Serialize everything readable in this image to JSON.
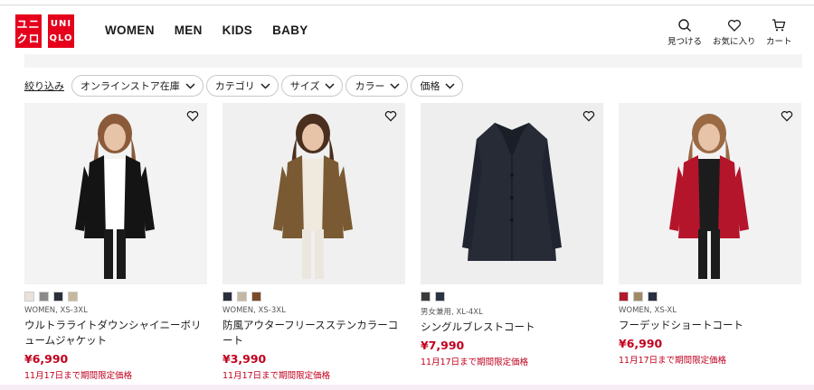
{
  "header": {
    "logo_jp_lines": [
      "ユニ",
      "クロ"
    ],
    "logo_en_lines": [
      "UNI",
      "QLO"
    ],
    "nav": [
      "WOMEN",
      "MEN",
      "KIDS",
      "BABY"
    ],
    "icons": [
      {
        "icon": "search-icon",
        "label": "見つける"
      },
      {
        "icon": "heart-icon",
        "label": "お気に入り"
      },
      {
        "icon": "cart-icon",
        "label": "カート"
      }
    ]
  },
  "strip": {
    "text": "",
    "link": ""
  },
  "filters": {
    "label": "絞り込み",
    "pills": [
      "オンラインストア在庫",
      "カテゴリ",
      "サイズ",
      "カラー",
      "価格"
    ]
  },
  "products": [
    {
      "swatches": [
        "#e8e2d8",
        "#8a8a8a",
        "#2b2f3a",
        "#c9b79e"
      ],
      "meta": "WOMEN, XS-3XL",
      "name": "ウルトラライトダウンシャイニーボリュームジャケット",
      "price": "¥6,990",
      "limited": "11月17日まで期間限定価格",
      "colors": {
        "bg": "#f3f3f3",
        "main": "#141414",
        "skin": "#e7c3a8",
        "hair": "#8a5a3a",
        "inner": "#ffffff",
        "bottom": "#1a1a1a"
      }
    },
    {
      "swatches": [
        "#2a2f3c",
        "#c5b8a3",
        "#7a4a28"
      ],
      "meta": "WOMEN, XS-3XL",
      "name": "防風アウターフリースステンカラーコート",
      "price": "¥3,990",
      "limited": "11月17日まで期間限定価格",
      "colors": {
        "bg": "#f0f0f0",
        "main": "#7a5a33",
        "skin": "#e7c3a8",
        "hair": "#4a2e1e",
        "inner": "#efe9de",
        "bottom": "#ece7de"
      }
    },
    {
      "swatches": [
        "#3a3a3a",
        "#2c3342"
      ],
      "meta": "男女兼用, XL-4XL",
      "name": "シングルブレストコート",
      "price": "¥7,990",
      "limited": "11月17日まで期間限定価格",
      "colors": {
        "bg": "#eeeeee",
        "main": "#262b36",
        "skin": "#eeeeee",
        "hair": "#eeeeee",
        "inner": "#262b36",
        "bottom": "#eeeeee"
      }
    },
    {
      "swatches": [
        "#b3192c",
        "#a08a66",
        "#2b3040"
      ],
      "meta": "WOMEN, XS-XL",
      "name": "フーデッドショートコート",
      "price": "¥6,990",
      "limited": "11月17日まで期間限定価格",
      "colors": {
        "bg": "#f2f2f2",
        "main": "#b5152b",
        "skin": "#e7c3a8",
        "hair": "#9a6a44",
        "inner": "#1c1c1c",
        "bottom": "#1c1c1c"
      }
    }
  ]
}
